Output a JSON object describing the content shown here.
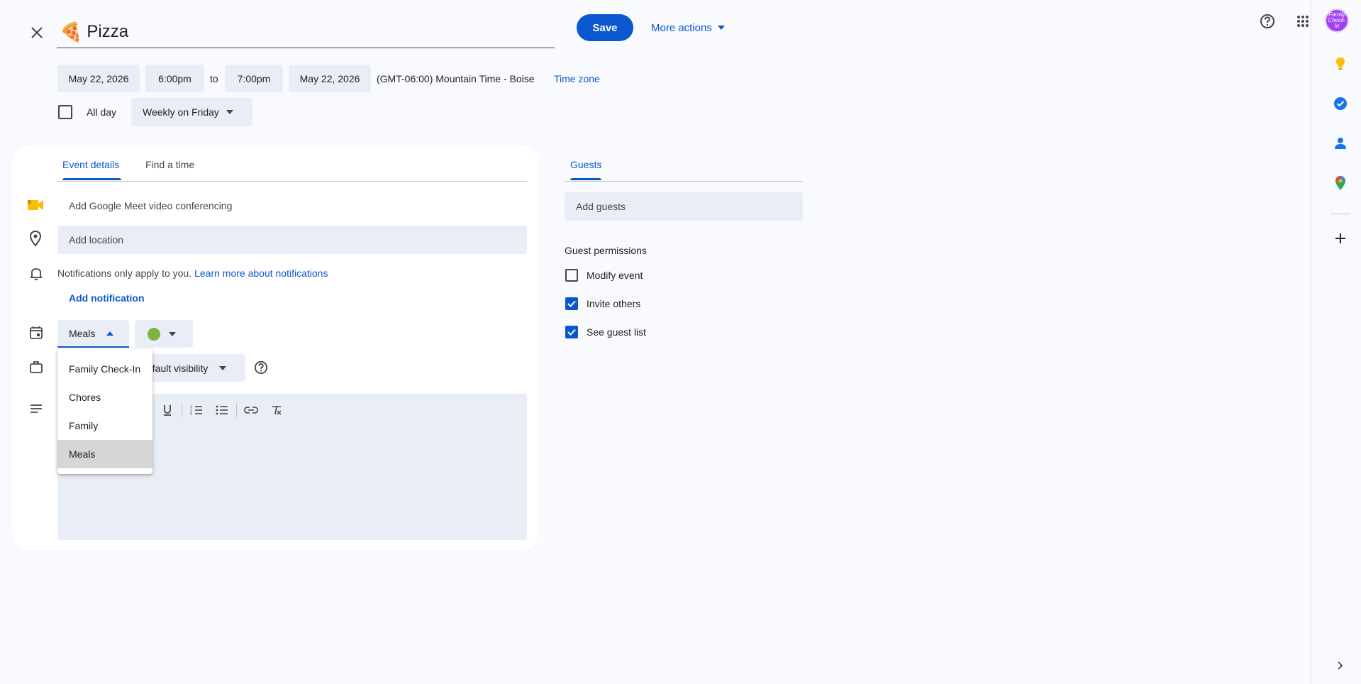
{
  "header": {
    "title_emoji": "🍕",
    "title": "Pizza",
    "save_label": "Save",
    "more_actions_label": "More actions",
    "avatar_text": "Family Check-In"
  },
  "datetime": {
    "start_date": "May 22, 2026",
    "start_time": "6:00pm",
    "to_label": "to",
    "end_time": "7:00pm",
    "end_date": "May 22, 2026",
    "timezone_text": "(GMT-06:00) Mountain Time - Boise",
    "timezone_link": "Time zone",
    "all_day_label": "All day",
    "all_day_checked": false,
    "repeat_value": "Weekly on Friday"
  },
  "details": {
    "tabs": [
      {
        "label": "Event details",
        "active": true
      },
      {
        "label": "Find a time",
        "active": false
      }
    ],
    "meet_label": "Add Google Meet video conferencing",
    "location_placeholder": "Add location",
    "notification_text": "Notifications only apply to you.",
    "notification_link": "Learn more about notifications",
    "add_notification_label": "Add notification",
    "calendar_value": "Meals",
    "event_color": "#7cb342",
    "visibility_value": "Default visibility",
    "visibility_partial": "efault visibility"
  },
  "calendar_dropdown": {
    "options": [
      "Family Check-In",
      "Chores",
      "Family",
      "Meals"
    ],
    "selected": "Meals"
  },
  "guests": {
    "tab_label": "Guests",
    "input_placeholder": "Add guests",
    "permissions_label": "Guest permissions",
    "permissions": [
      {
        "label": "Modify event",
        "checked": false
      },
      {
        "label": "Invite others",
        "checked": true
      },
      {
        "label": "See guest list",
        "checked": true
      }
    ]
  },
  "colors": {
    "accent": "#0b57d0",
    "field_bg": "#e9eef6",
    "page_bg": "#f8fafd"
  },
  "side_panel": {
    "icons": [
      "keep-icon",
      "tasks-icon",
      "contacts-icon",
      "maps-icon",
      "add-icon",
      "expand-icon"
    ]
  }
}
